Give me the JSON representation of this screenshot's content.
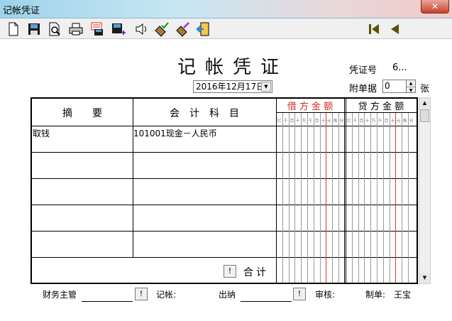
{
  "window": {
    "title": "记帐凭证",
    "close_glyph": "✕"
  },
  "toolbar": {
    "buttons": [
      {
        "name": "new-doc-icon"
      },
      {
        "name": "save-icon"
      },
      {
        "name": "preview-icon"
      },
      {
        "name": "print-icon"
      },
      {
        "name": "export-icon"
      },
      {
        "name": "save-as-icon"
      },
      {
        "name": "speaker-icon"
      },
      {
        "name": "check-icon"
      },
      {
        "name": "edit-icon"
      },
      {
        "name": "exit-icon"
      },
      {
        "name": "first-icon"
      },
      {
        "name": "prev-icon"
      }
    ]
  },
  "voucher": {
    "heading": "记帐凭证",
    "date": "2016年12月17日",
    "voucher_no_label": "凭证号",
    "voucher_no_value": "6...",
    "attachment_label": "附单据",
    "attachment_value": "0",
    "attachment_unit": "张"
  },
  "table": {
    "headers": {
      "summary": "摘　　要",
      "account": "会　计　科　目",
      "debit": "借 方 金 额",
      "credit": "贷 方 金 额"
    },
    "digit_labels": [
      "亿",
      "千",
      "百",
      "十",
      "万",
      "千",
      "百",
      "十",
      "元",
      "角",
      "分"
    ],
    "rows": [
      {
        "summary": "取钱",
        "account": "101001现金－人民币"
      },
      {
        "summary": "",
        "account": ""
      },
      {
        "summary": "",
        "account": ""
      },
      {
        "summary": "",
        "account": ""
      },
      {
        "summary": "",
        "account": ""
      }
    ],
    "total_label": "合计",
    "total_button": "!"
  },
  "footer": {
    "finance_label": "财务主管",
    "finance_button": "!",
    "bookkeeper_label": "记帐:",
    "cashier_label": "出纳",
    "cashier_button": "!",
    "reviewer_label": "审核:",
    "maker_label": "制单:",
    "maker_value": "王宝"
  },
  "colors": {
    "debit_header": "#d22b1e",
    "accent_line": "#d93a2b"
  }
}
